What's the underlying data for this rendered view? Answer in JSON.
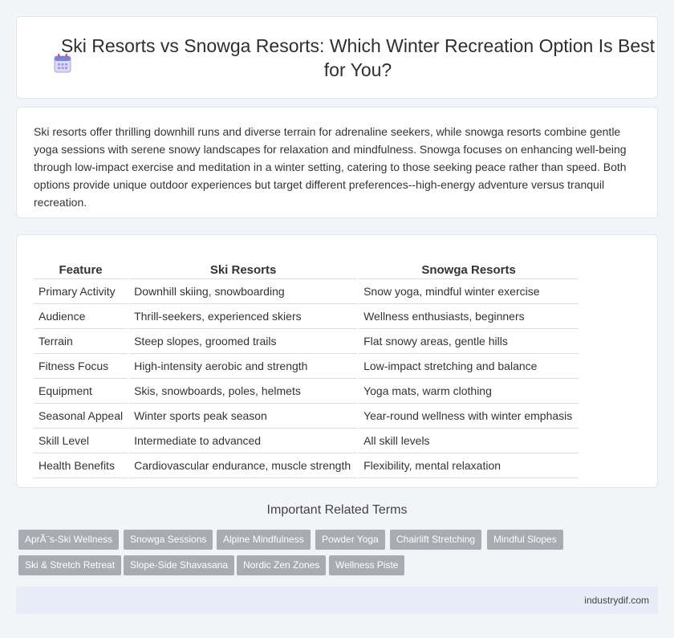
{
  "header": {
    "title": "Ski Resorts vs Snowga Resorts: Which Winter Recreation Option Is Best for You?",
    "icon": "calendar-icon"
  },
  "intro": {
    "text": "Ski resorts offer thrilling downhill runs and diverse terrain for adrenaline seekers, while snowga resorts combine gentle yoga sessions with serene snowy landscapes for relaxation and mindfulness. Snowga focuses on enhancing well-being through low-impact exercise and meditation in a winter setting, catering to those seeking peace rather than speed. Both options provide unique outdoor experiences but target different preferences--high-energy adventure versus tranquil recreation."
  },
  "table": {
    "headers": [
      "Feature",
      "Ski Resorts",
      "Snowga Resorts"
    ],
    "rows": [
      [
        "Primary Activity",
        "Downhill skiing, snowboarding",
        "Snow yoga, mindful winter exercise"
      ],
      [
        "Audience",
        "Thrill-seekers, experienced skiers",
        "Wellness enthusiasts, beginners"
      ],
      [
        "Terrain",
        "Steep slopes, groomed trails",
        "Flat snowy areas, gentle hills"
      ],
      [
        "Fitness Focus",
        "High-intensity aerobic and strength",
        "Low-impact stretching and balance"
      ],
      [
        "Equipment",
        "Skis, snowboards, poles, helmets",
        "Yoga mats, warm clothing"
      ],
      [
        "Seasonal Appeal",
        "Winter sports peak season",
        "Year-round wellness with winter emphasis"
      ],
      [
        "Skill Level",
        "Intermediate to advanced",
        "All skill levels"
      ],
      [
        "Health Benefits",
        "Cardiovascular endurance, muscle strength",
        "Flexibility, mental relaxation"
      ]
    ]
  },
  "terms": {
    "title": "Important Related Terms",
    "tags": [
      "AprÃ¨s-Ski Wellness",
      "Snowga Sessions",
      "Alpine Mindfulness",
      "Powder Yoga",
      "Chairlift Stretching",
      "Mindful Slopes",
      "Ski & Stretch Retreat",
      "Slope-Side Shavasana",
      "Nordic Zen Zones",
      "Wellness Piste"
    ]
  },
  "footer": {
    "text": "industrydif.com"
  },
  "colors": {
    "tag_bg": "#a9abb3",
    "footer_bg": "#e8ecf6",
    "page_bg": "#f3f4f8"
  }
}
